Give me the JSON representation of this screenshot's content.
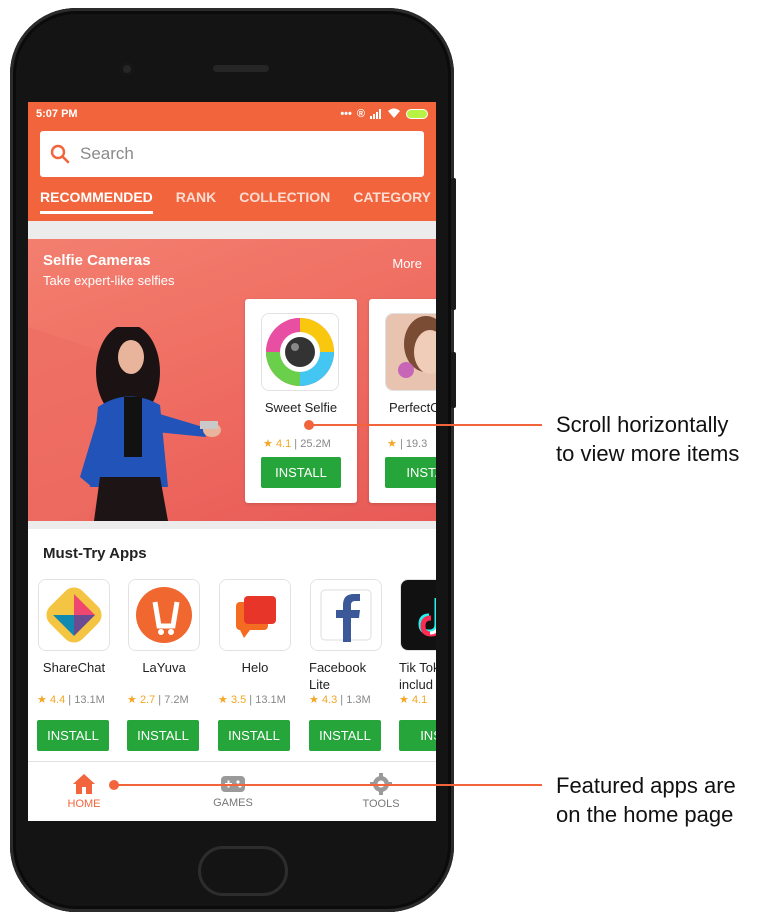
{
  "status_bar": {
    "time": "5:07 PM",
    "icons": [
      "dots-icon",
      "registered-icon",
      "signal-icon",
      "wifi-icon",
      "battery-icon"
    ]
  },
  "search": {
    "placeholder": "Search"
  },
  "tabs": [
    {
      "label": "RECOMMENDED",
      "active": true
    },
    {
      "label": "RANK",
      "active": false
    },
    {
      "label": "COLLECTION",
      "active": false
    },
    {
      "label": "CATEGORY",
      "active": false
    }
  ],
  "selfie_section": {
    "title": "Selfie Cameras",
    "subtitle": "Take expert-like selfies",
    "more_label": "More",
    "apps": [
      {
        "name": "Sweet Selfie",
        "rating": "4.1",
        "downloads": "25.2M",
        "install_label": "INSTALL"
      },
      {
        "name": "PerfectC",
        "rating": "",
        "downloads": "19.3",
        "install_label": "INSTA"
      }
    ]
  },
  "must_try": {
    "title": "Must-Try Apps",
    "apps": [
      {
        "name": "ShareChat",
        "rating": "4.4",
        "downloads": "13.1M",
        "install_label": "INSTALL"
      },
      {
        "name": "LaYuva",
        "rating": "2.7",
        "downloads": "7.2M",
        "install_label": "INSTALL"
      },
      {
        "name": "Helo",
        "rating": "3.5",
        "downloads": "13.1M",
        "install_label": "INSTALL"
      },
      {
        "name": "Facebook Lite",
        "rating": "4.3",
        "downloads": "1.3M",
        "install_label": "INSTALL"
      },
      {
        "name": "Tik Tok includ",
        "rating": "4.1",
        "downloads": "",
        "install_label": "INST"
      }
    ]
  },
  "bottom_nav": [
    {
      "label": "HOME",
      "icon": "home-icon",
      "active": true
    },
    {
      "label": "GAMES",
      "icon": "gamepad-icon",
      "active": false
    },
    {
      "label": "TOOLS",
      "icon": "gear-icon",
      "active": false
    }
  ],
  "callouts": {
    "scroll_line1": "Scroll horizontally",
    "scroll_line2": "to view more items",
    "featured_line1": "Featured apps are",
    "featured_line2": "on the home page"
  },
  "colors": {
    "accent": "#f2643b",
    "install_green": "#26a53b",
    "banner": "#ee6a60",
    "star": "#f5a623"
  }
}
